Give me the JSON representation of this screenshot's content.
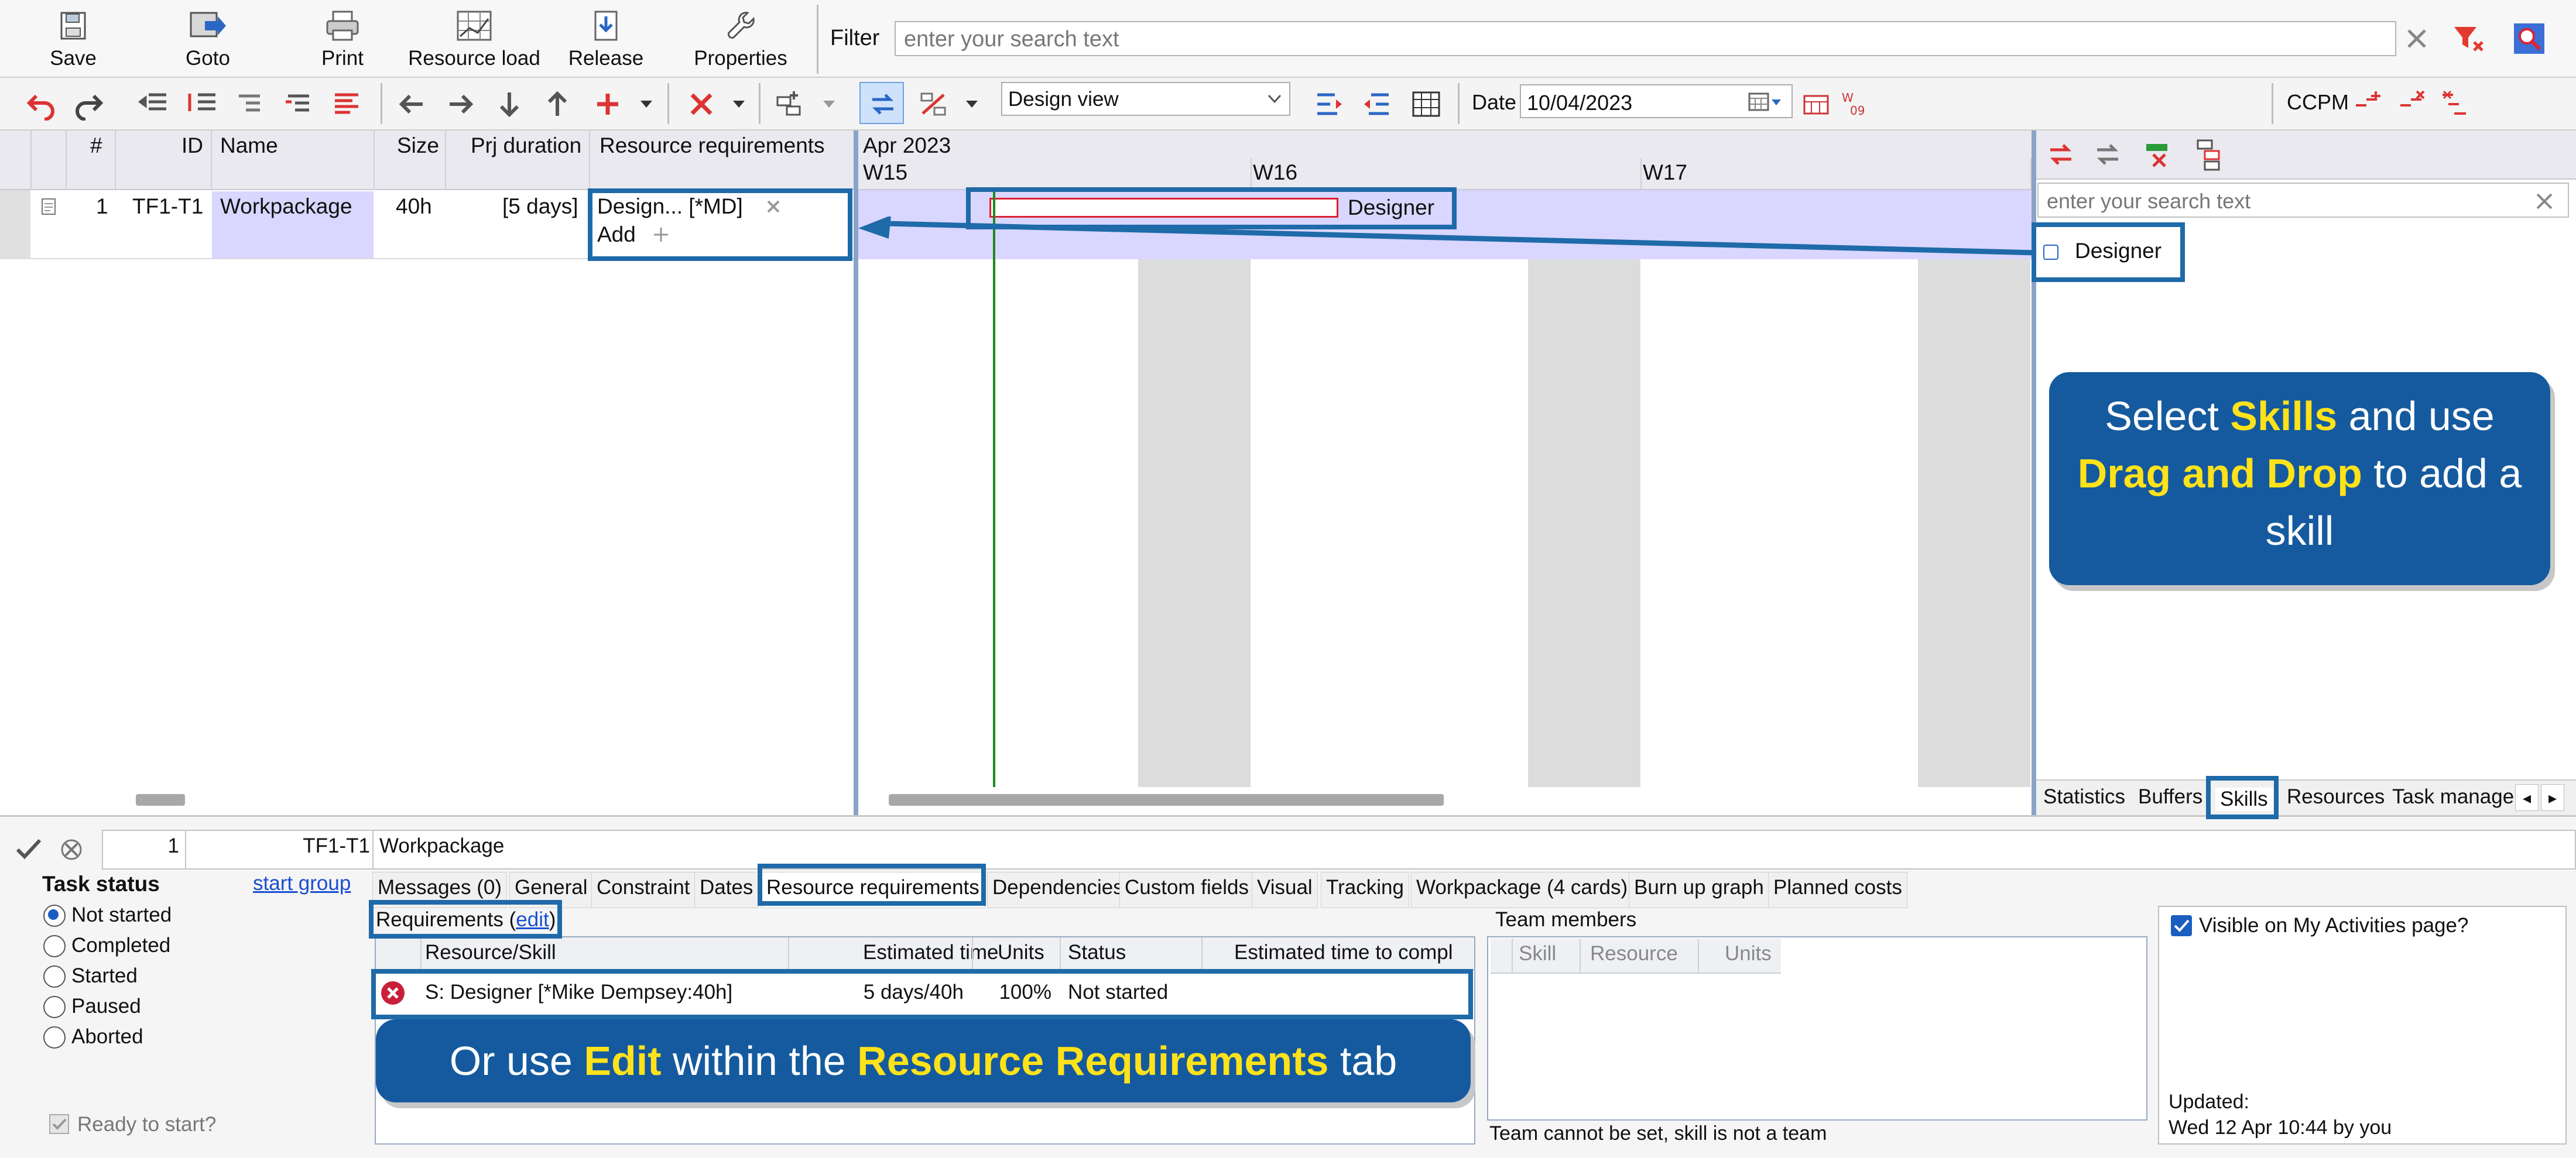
{
  "toolbar": {
    "save": "Save",
    "goto": "Goto",
    "print": "Print",
    "resource_load": "Resource load",
    "release": "Release",
    "properties": "Properties",
    "filter_label": "Filter",
    "filter_placeholder": "enter your search text"
  },
  "toolbar2": {
    "view": "Design view",
    "date_label": "Date",
    "date_value": "10/04/2023",
    "ccpm_label": "CCPM"
  },
  "grid": {
    "columns": [
      "#",
      "ID",
      "Name",
      "Size",
      "Prj duration",
      "Resource requirements"
    ],
    "row": {
      "num": "1",
      "id": "TF1-T1",
      "name": "Workpackage",
      "size": "40h",
      "duration": "[5 days]",
      "req": "Design... [*MD]",
      "add": "Add"
    }
  },
  "gantt": {
    "month": "Apr 2023",
    "weeks": [
      "W15",
      "W16",
      "W17"
    ],
    "bar_label": "Designer"
  },
  "right_panel": {
    "search_placeholder": "enter your search text",
    "skill_item": "Designer",
    "tabs": [
      "Statistics",
      "Buffers",
      "Skills",
      "Resources",
      "Task manage"
    ]
  },
  "callouts": {
    "skills_1": "Select ",
    "skills_2": "Skills",
    "skills_3": " and use ",
    "skills_4": "Drag and Drop",
    "skills_5": " to add a skill",
    "edit_1": "Or use ",
    "edit_2": "Edit",
    "edit_3": " within the ",
    "edit_4": "Resource Requirements",
    "edit_5": " tab"
  },
  "bottom": {
    "num": "1",
    "id": "TF1-T1",
    "name": "Workpackage",
    "task_status_label": "Task status",
    "start_group": "start group",
    "statuses": [
      "Not started",
      "Completed",
      "Started",
      "Paused",
      "Aborted"
    ],
    "ready": "Ready to start?",
    "tabs": [
      "Messages (0)",
      "General",
      "Constraint",
      "Dates",
      "Resource requirements",
      "Dependencies",
      "Custom fields",
      "Visual",
      "Tracking",
      "Workpackage (4 cards)",
      "Burn up graph",
      "Planned costs"
    ],
    "requirements_label": "Requirements (",
    "edit_link": "edit",
    "requirements_close": ")",
    "req_columns": [
      "Resource/Skill",
      "Estimated time",
      "Units",
      "Status",
      "Estimated time to compl"
    ],
    "req_row": {
      "skill": "S: Designer [*Mike Dempsey:40h]",
      "time": "5 days/40h",
      "units": "100%",
      "status": "Not started"
    },
    "team_members_label": "Team members",
    "team_columns": [
      "Skill",
      "Resource",
      "Units"
    ],
    "team_note": "Team cannot be set, skill is not a team",
    "visible_label": "Visible on My Activities page?",
    "updated_label": "Updated:",
    "updated_value": "Wed 12 Apr 10:44 by you"
  },
  "colors": {
    "accent": "#1f6aa8",
    "callout_bg": "#155a9e",
    "highlight_text": "#ffe21a",
    "gantt_row": "#d9d6ff"
  }
}
